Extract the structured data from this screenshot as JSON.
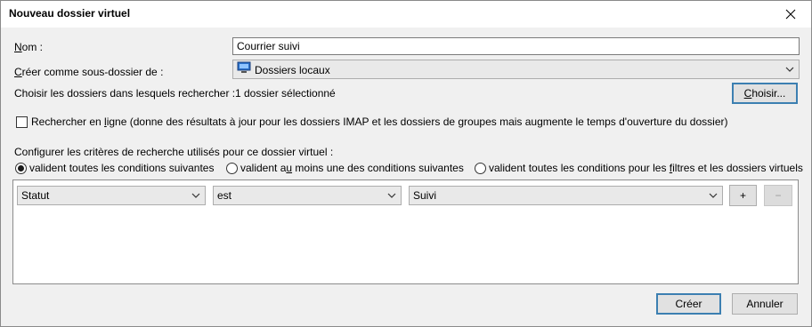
{
  "window": {
    "title": "Nouveau dossier virtuel"
  },
  "form": {
    "name_label_u": "N",
    "name_label_rest": "om :",
    "name_value": "Courrier suivi",
    "parent_label_u": "C",
    "parent_label_rest": "réer comme sous-dossier de :",
    "parent_value": "Dossiers locaux",
    "folders_label": "Choisir les dossiers dans lesquels rechercher :",
    "folders_value": "1 dossier sélectionné",
    "choose_button_u": "C",
    "choose_button_rest": "hoisir...",
    "online_pre": "Rechercher en ",
    "online_u": "l",
    "online_post": "igne (donne des résultats à jour pour les dossiers IMAP et les dossiers de groupes mais augmente le temps d'ouverture du dossier)",
    "online_checked": false
  },
  "criteria": {
    "label": "Configurer les critères de recherche utilisés pour ce dossier virtuel :",
    "radio_all": "valident toutes les conditions suivantes",
    "radio_any_pre": "valident a",
    "radio_any_u": "u",
    "radio_any_post": " moins une des conditions suivantes",
    "radio_filters_pre": "valident toutes les conditions pour les ",
    "radio_filters_u": "f",
    "radio_filters_post": "iltres et les dossiers virtuels",
    "selected": "all",
    "rule": {
      "field": "Statut",
      "operator": "est",
      "value": "Suivi",
      "add": "+",
      "remove": "−"
    }
  },
  "buttons": {
    "create": "Créer",
    "cancel": "Annuler"
  }
}
